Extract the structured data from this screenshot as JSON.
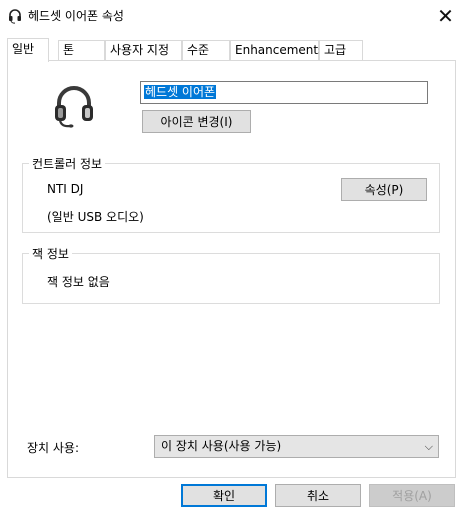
{
  "window": {
    "title": "헤드셋 이어폰 속성",
    "close_glyph": "✕"
  },
  "tabs": [
    {
      "label": "일반",
      "active": true
    },
    {
      "label": "톤"
    },
    {
      "label": "사용자 지정"
    },
    {
      "label": "수준"
    },
    {
      "label": "Enhancements"
    },
    {
      "label": "고급"
    }
  ],
  "device": {
    "icon": "headset-icon",
    "name_value": "헤드셋 이어폰",
    "change_icon_label": "아이콘 변경(I)"
  },
  "controller": {
    "title": "컨트롤러 정보",
    "name": "NTI DJ",
    "type": "(일반 USB 오디오)",
    "properties_label": "속성(P)"
  },
  "jack": {
    "title": "잭 정보",
    "text": "잭 정보 없음"
  },
  "usage": {
    "label": "장치 사용:",
    "selected": "이 장치 사용(사용 가능)"
  },
  "footer": {
    "ok_label": "확인",
    "cancel_label": "취소",
    "apply_label": "적용(A)"
  },
  "colors": {
    "accent": "#0078d7",
    "button_face": "#e1e1e1",
    "disabled_text": "#a0a0a0"
  }
}
